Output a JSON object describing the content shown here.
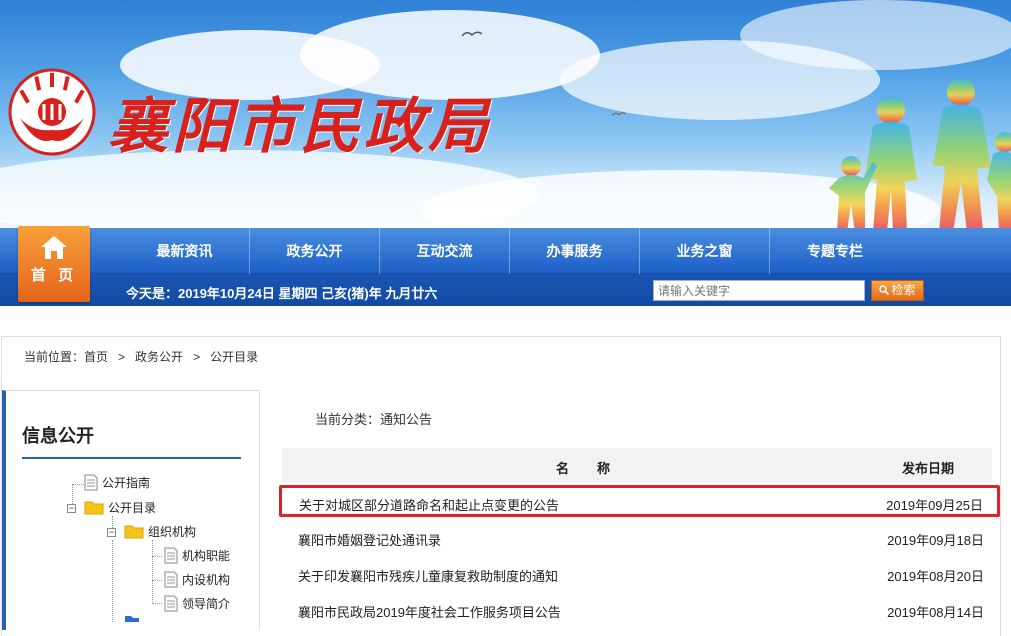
{
  "header": {
    "site_title": "襄阳市民政局",
    "brand_color": "#d8201c"
  },
  "nav": {
    "home_label": "首 页",
    "items": [
      "最新资讯",
      "政务公开",
      "互动交流",
      "办事服务",
      "业务之窗",
      "专题专栏"
    ]
  },
  "datebar": {
    "prefix": "今天是：",
    "date": "2019年10月24日 星期四 己亥(猪)年 九月廿六"
  },
  "search": {
    "placeholder": "请输入关键字",
    "button_label": "检索"
  },
  "breadcrumb": {
    "label": "当前位置：",
    "items": [
      "首页",
      "政务公开",
      "公开目录"
    ],
    "separator": ">"
  },
  "sidebar": {
    "title": "信息公开",
    "tree": {
      "n1": "公开指南",
      "n2": "公开目录",
      "n3": "组织机构",
      "n4": "机构职能",
      "n5": "内设机构",
      "n6": "领导简介"
    }
  },
  "main": {
    "category_label": "当前分类：",
    "category_value": "通知公告",
    "col_name": "名称",
    "col_date": "发布日期",
    "rows": [
      {
        "title": "关于对城区部分道路命名和起止点变更的公告",
        "date": "2019年09月25日"
      },
      {
        "title": "襄阳市婚姻登记处通讯录",
        "date": "2019年09月18日"
      },
      {
        "title": "关于印发襄阳市残疾儿童康复救助制度的通知",
        "date": "2019年08月20日"
      },
      {
        "title": "襄阳市民政局2019年度社会工作服务项目公告",
        "date": "2019年08月14日"
      }
    ]
  }
}
